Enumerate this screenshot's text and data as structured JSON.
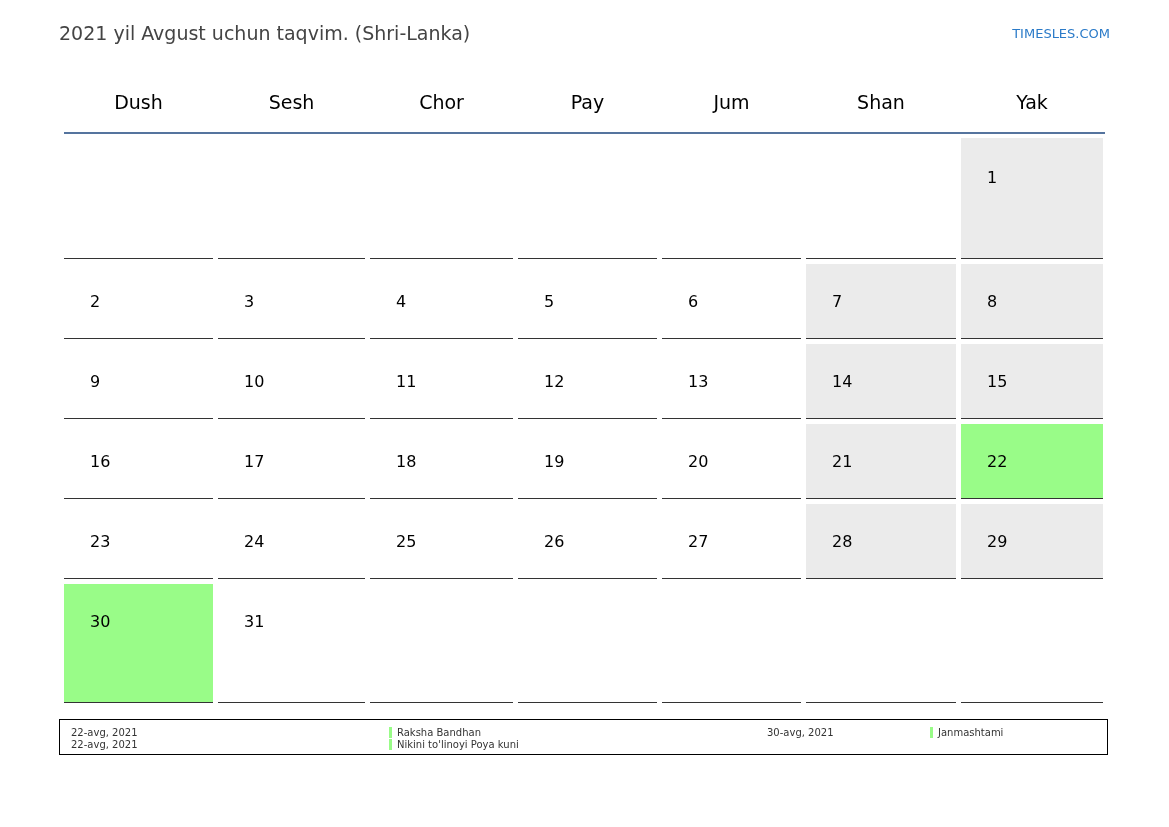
{
  "title": "2021 yil Avgust uchun taqvim. (Shri-Lanka)",
  "site_link": "TIMESLES.COM",
  "weekdays": [
    "Dush",
    "Sesh",
    "Chor",
    "Pay",
    "Jum",
    "Shan",
    "Yak"
  ],
  "weeks": [
    [
      {
        "kind": "empty"
      },
      {
        "kind": "empty"
      },
      {
        "kind": "empty"
      },
      {
        "kind": "empty"
      },
      {
        "kind": "empty"
      },
      {
        "kind": "empty"
      },
      {
        "kind": "day",
        "day": "1",
        "weekend": true,
        "holiday": false
      }
    ],
    [
      {
        "kind": "day",
        "day": "2",
        "weekend": false,
        "holiday": false
      },
      {
        "kind": "day",
        "day": "3",
        "weekend": false,
        "holiday": false
      },
      {
        "kind": "day",
        "day": "4",
        "weekend": false,
        "holiday": false
      },
      {
        "kind": "day",
        "day": "5",
        "weekend": false,
        "holiday": false
      },
      {
        "kind": "day",
        "day": "6",
        "weekend": false,
        "holiday": false
      },
      {
        "kind": "day",
        "day": "7",
        "weekend": true,
        "holiday": false
      },
      {
        "kind": "day",
        "day": "8",
        "weekend": true,
        "holiday": false
      }
    ],
    [
      {
        "kind": "day",
        "day": "9",
        "weekend": false,
        "holiday": false
      },
      {
        "kind": "day",
        "day": "10",
        "weekend": false,
        "holiday": false
      },
      {
        "kind": "day",
        "day": "11",
        "weekend": false,
        "holiday": false
      },
      {
        "kind": "day",
        "day": "12",
        "weekend": false,
        "holiday": false
      },
      {
        "kind": "day",
        "day": "13",
        "weekend": false,
        "holiday": false
      },
      {
        "kind": "day",
        "day": "14",
        "weekend": true,
        "holiday": false
      },
      {
        "kind": "day",
        "day": "15",
        "weekend": true,
        "holiday": false
      }
    ],
    [
      {
        "kind": "day",
        "day": "16",
        "weekend": false,
        "holiday": false
      },
      {
        "kind": "day",
        "day": "17",
        "weekend": false,
        "holiday": false
      },
      {
        "kind": "day",
        "day": "18",
        "weekend": false,
        "holiday": false
      },
      {
        "kind": "day",
        "day": "19",
        "weekend": false,
        "holiday": false
      },
      {
        "kind": "day",
        "day": "20",
        "weekend": false,
        "holiday": false
      },
      {
        "kind": "day",
        "day": "21",
        "weekend": true,
        "holiday": false
      },
      {
        "kind": "day",
        "day": "22",
        "holiday": true
      }
    ],
    [
      {
        "kind": "day",
        "day": "23",
        "weekend": false,
        "holiday": false
      },
      {
        "kind": "day",
        "day": "24",
        "weekend": false,
        "holiday": false
      },
      {
        "kind": "day",
        "day": "25",
        "weekend": false,
        "holiday": false
      },
      {
        "kind": "day",
        "day": "26",
        "weekend": false,
        "holiday": false
      },
      {
        "kind": "day",
        "day": "27",
        "weekend": false,
        "holiday": false
      },
      {
        "kind": "day",
        "day": "28",
        "weekend": true,
        "holiday": false
      },
      {
        "kind": "day",
        "day": "29",
        "weekend": true,
        "holiday": false
      }
    ],
    [
      {
        "kind": "day",
        "day": "30",
        "holiday": true
      },
      {
        "kind": "day",
        "day": "31",
        "weekend": false,
        "holiday": false
      },
      {
        "kind": "empty"
      },
      {
        "kind": "empty"
      },
      {
        "kind": "empty"
      },
      {
        "kind": "empty"
      },
      {
        "kind": "empty"
      }
    ]
  ],
  "legend_groups": [
    {
      "items": [
        {
          "date": "22-avg, 2021",
          "name": "Raksha Bandhan",
          "color": "#99fc88"
        },
        {
          "date": "22-avg, 2021",
          "name": "Nikini to'linoyi Poya kuni",
          "color": "#99fc88"
        }
      ]
    },
    {
      "items": [
        {
          "date": "30-avg, 2021",
          "name": "Janmashtami",
          "color": "#99fc88"
        }
      ]
    }
  ]
}
